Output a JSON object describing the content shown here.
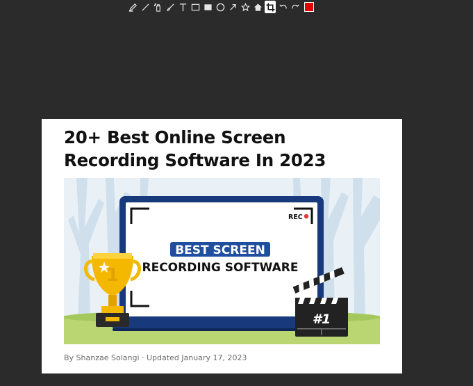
{
  "toolbar": {
    "tools": [
      {
        "icon": "marker-icon"
      },
      {
        "icon": "line-icon"
      },
      {
        "icon": "spray-icon"
      },
      {
        "icon": "brush-icon"
      },
      {
        "icon": "text-icon",
        "glyph": "T"
      },
      {
        "icon": "rectangle-outline-icon"
      },
      {
        "icon": "rectangle-filled-icon"
      },
      {
        "icon": "circle-icon"
      },
      {
        "icon": "arrow-icon"
      },
      {
        "icon": "star-icon"
      },
      {
        "icon": "home-icon"
      },
      {
        "icon": "crop-icon",
        "active": true
      },
      {
        "icon": "undo-icon"
      },
      {
        "icon": "redo-icon"
      }
    ],
    "current_color": "#e00000"
  },
  "article": {
    "title": "20+ Best Online Screen Recording Software In 2023",
    "image": {
      "rec_label": "REC",
      "headline_line1": "BEST SCREEN",
      "headline_line2": "RECORDING SOFTWARE",
      "trophy_number": "1",
      "clapper_label": "#1"
    },
    "meta": "By Shanzae Solangi · Updated January 17, 2023"
  }
}
